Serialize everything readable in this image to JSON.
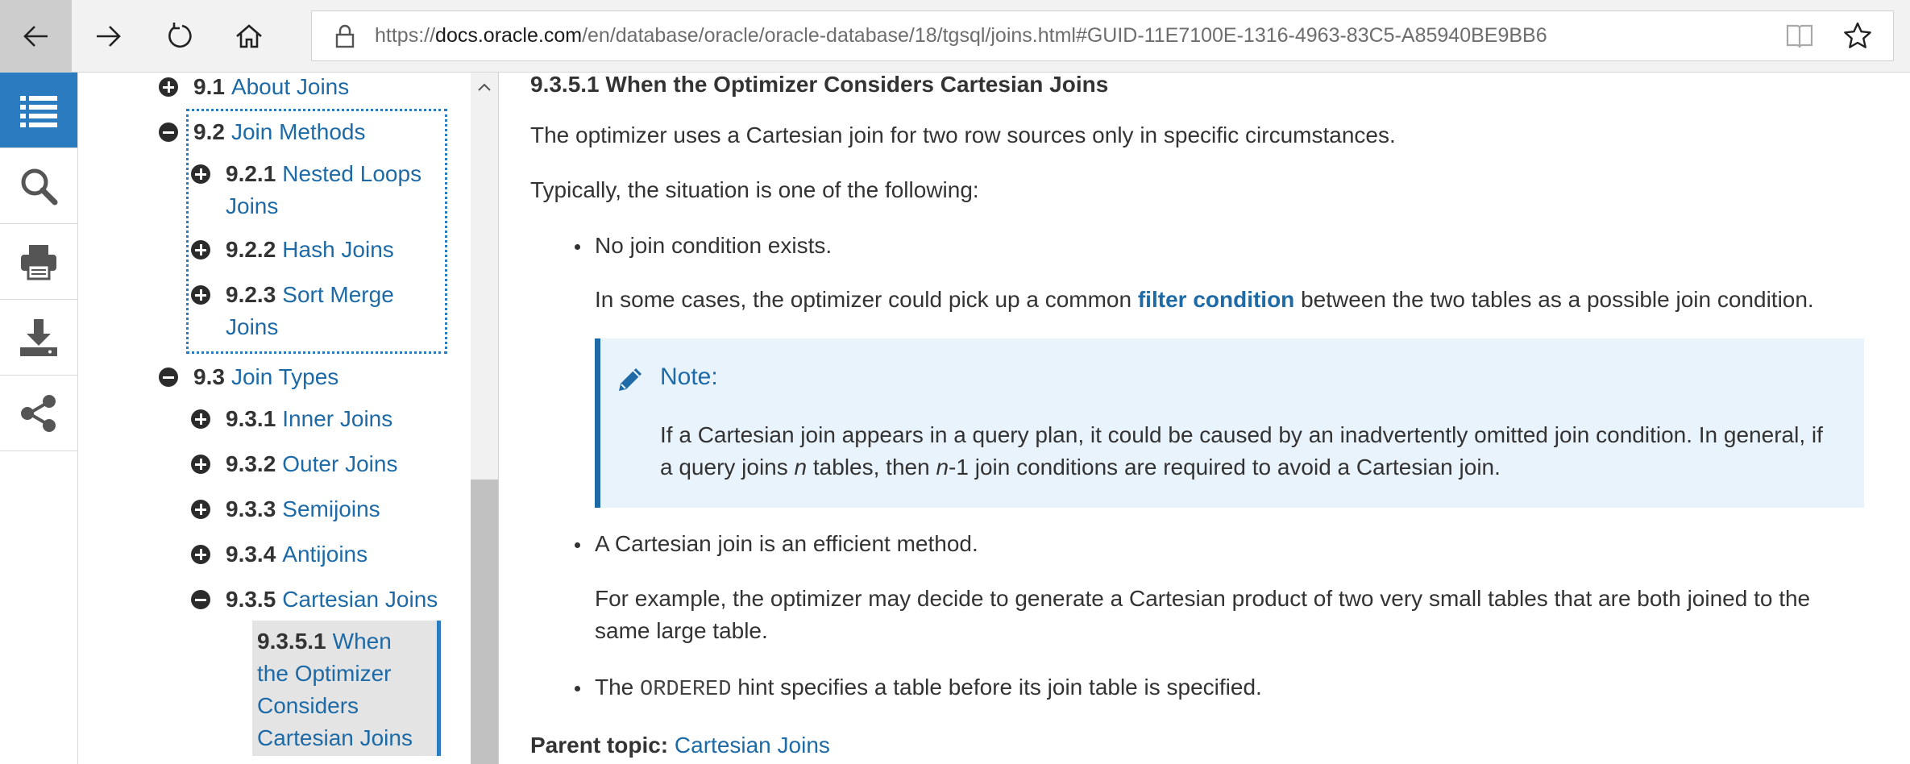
{
  "browser": {
    "url_prefix": "https://",
    "url_host": "docs.oracle.com",
    "url_path": "/en/database/oracle/oracle-database/18/tgsql/joins.html#GUID-11E7100E-1316-4963-83C5-A85940BE9BB6"
  },
  "rail": [
    "list-icon",
    "search-icon",
    "print-icon",
    "download-icon",
    "share-icon"
  ],
  "toc": {
    "items": [
      {
        "num": "9.1",
        "label": "About Joins",
        "state": "plus"
      },
      {
        "num": "9.2",
        "label": "Join Methods",
        "state": "minus"
      },
      {
        "num": "9.2.1",
        "label_line1": "Nested Loops",
        "label_line2": "Joins",
        "state": "plus"
      },
      {
        "num": "9.2.2",
        "label": "Hash Joins",
        "state": "plus"
      },
      {
        "num": "9.2.3",
        "label_line1": "Sort Merge",
        "label_line2": "Joins",
        "state": "plus"
      },
      {
        "num": "9.3",
        "label": "Join Types",
        "state": "minus"
      },
      {
        "num": "9.3.1",
        "label": "Inner Joins",
        "state": "plus"
      },
      {
        "num": "9.3.2",
        "label": "Outer Joins",
        "state": "plus"
      },
      {
        "num": "9.3.3",
        "label": "Semijoins",
        "state": "plus"
      },
      {
        "num": "9.3.4",
        "label": "Antijoins",
        "state": "plus"
      },
      {
        "num": "9.3.5",
        "label": "Cartesian Joins",
        "state": "minus"
      },
      {
        "num": "9.3.5.1",
        "label_line1": "When",
        "label_line2": "the Optimizer",
        "label_line3": "Considers",
        "label_line4": "Cartesian Joins",
        "state": "current"
      }
    ]
  },
  "content": {
    "title": "9.3.5.1 When the Optimizer Considers Cartesian Joins",
    "intro": "The optimizer uses a Cartesian join for two row sources only in specific circumstances.",
    "typically": "Typically, the situation is one of the following:",
    "bullet1": "No join condition exists.",
    "bullet1_para_pre": "In some cases, the optimizer could pick up a common ",
    "bullet1_para_term": "filter condition",
    "bullet1_para_post": " between the two tables as a possible join condition.",
    "note_title": "Note:",
    "note_line1": "If a Cartesian join appears in a query plan, it could be caused by an inadvertently omitted join condition. In general, if",
    "note_line2_a": "a query joins ",
    "note_line2_n1": "n",
    "note_line2_b": " tables, then ",
    "note_line2_n2": "n",
    "note_line2_c": "-1 join conditions are required to avoid a Cartesian join.",
    "bullet2": "A Cartesian join is an efficient method.",
    "bullet2_para_line1": "For example, the optimizer may decide to generate a Cartesian product of two very small tables that are both joined to the",
    "bullet2_para_line2": "same large table.",
    "bullet3_pre": "The ",
    "bullet3_code": "ORDERED",
    "bullet3_post": " hint specifies a table before its join table is specified.",
    "parent_label": "Parent topic:",
    "parent_link": "Cartesian Joins"
  }
}
